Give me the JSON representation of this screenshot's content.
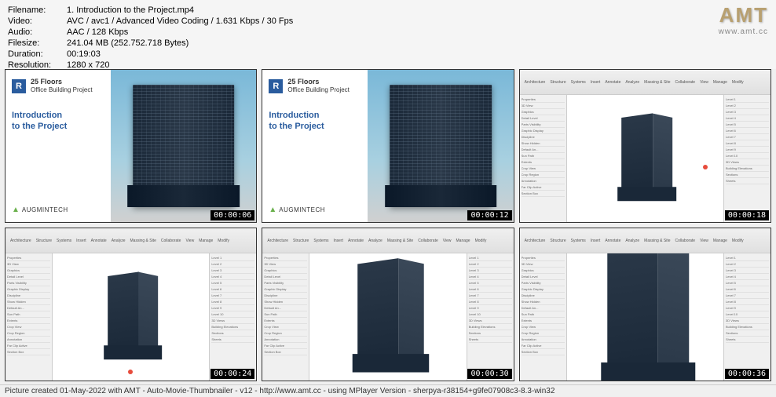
{
  "meta": {
    "filename_label": "Filename:",
    "filename": "1. Introduction to the Project.mp4",
    "video_label": "Video:",
    "video": "AVC / avc1 / Advanced Video Coding / 1.631 Kbps / 30 Fps",
    "audio_label": "Audio:",
    "audio": "AAC / 128 Kbps",
    "filesize_label": "Filesize:",
    "filesize": "241.04 MB (252.752.718 Bytes)",
    "duration_label": "Duration:",
    "duration": "00:19:03",
    "resolution_label": "Resolution:",
    "resolution": "1280 x 720"
  },
  "logo": {
    "text": "AMT",
    "url": "www.amt.cc"
  },
  "thumbnails": [
    {
      "timestamp": "00:00:06",
      "type": "title"
    },
    {
      "timestamp": "00:00:12",
      "type": "title"
    },
    {
      "timestamp": "00:00:18",
      "type": "app",
      "red_dot_pos": "right"
    },
    {
      "timestamp": "00:00:24",
      "type": "app",
      "red_dot_pos": "bottom"
    },
    {
      "timestamp": "00:00:30",
      "type": "app",
      "red_dot_pos": "none"
    },
    {
      "timestamp": "00:00:36",
      "type": "app",
      "red_dot_pos": "none"
    }
  ],
  "title_card": {
    "badge": "R",
    "project_line1": "25 Floors",
    "project_line2": "Office Building Project",
    "main_line1": "Introduction",
    "main_line2": "to the Project",
    "brand": "AUGMINTECH"
  },
  "revit_ribbon": [
    "Architecture",
    "Structure",
    "Systems",
    "Insert",
    "Annotate",
    "Analyze",
    "Massing & Site",
    "Collaborate",
    "View",
    "Manage",
    "Modify"
  ],
  "revit_panel_items": [
    "Properties",
    "3D View",
    "Graphics",
    "Detail Level",
    "Parts Visibility",
    "Graphic Display",
    "Discipline",
    "Show Hidden",
    "Default An...",
    "Sun Path",
    "Extents",
    "Crop View",
    "Crop Region",
    "Annotation",
    "Far Clip Active",
    "Section Box"
  ],
  "revit_browser_items": [
    "Level 1",
    "Level 2",
    "Level 3",
    "Level 4",
    "Level 5",
    "Level 6",
    "Level 7",
    "Level 8",
    "Level 9",
    "Level 10",
    "3D Views",
    "Building Elevations",
    "Sections",
    "Sheets"
  ],
  "footer": "Picture created 01-May-2022 with AMT - Auto-Movie-Thumbnailer - v12 - http://www.amt.cc - using MPlayer Version - sherpya-r38154+g9fe07908c3-8.3-win32"
}
